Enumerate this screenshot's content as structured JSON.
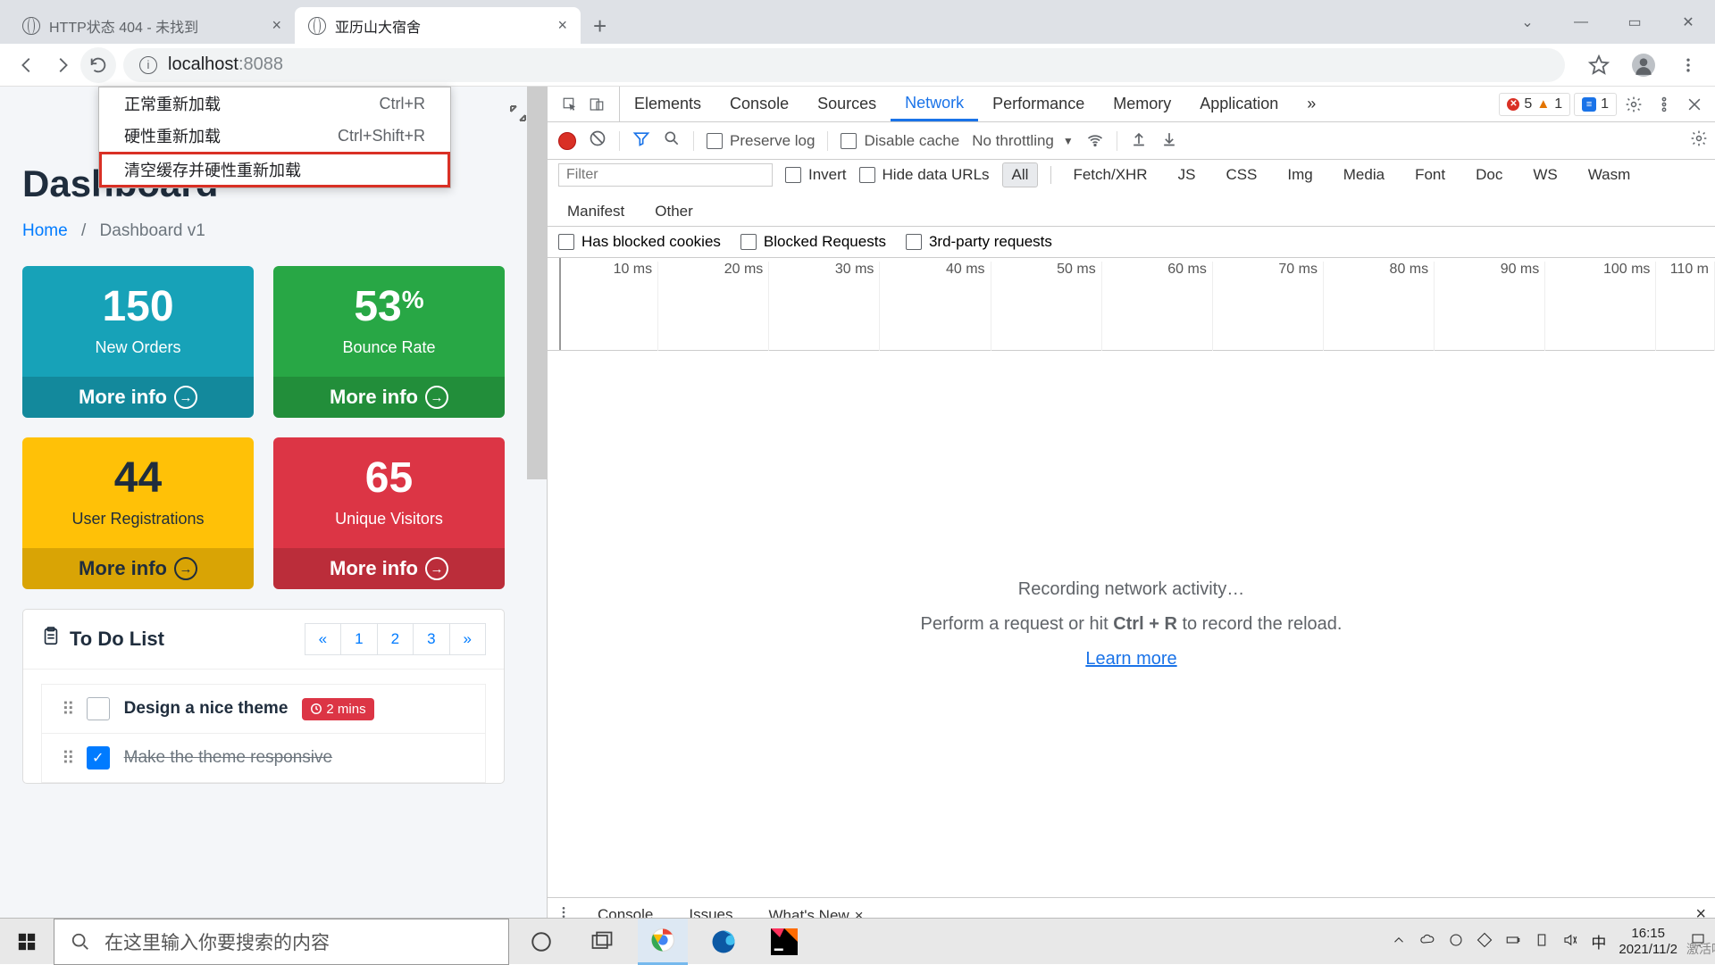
{
  "browser": {
    "tabs": [
      {
        "title": "HTTP状态 404 - 未找到",
        "active": false
      },
      {
        "title": "亚历山大宿舍",
        "active": true
      }
    ],
    "url_host": "localhost",
    "url_port": ":8088",
    "window_controls": {
      "dropdown": "⌄",
      "minimize": "—",
      "maximize": "▭",
      "close": "✕"
    }
  },
  "context_menu": {
    "items": [
      {
        "label": "正常重新加载",
        "shortcut": "Ctrl+R"
      },
      {
        "label": "硬性重新加载",
        "shortcut": "Ctrl+Shift+R"
      },
      {
        "label": "清空缓存并硬性重新加载",
        "shortcut": "",
        "highlighted": true
      }
    ]
  },
  "dashboard": {
    "title": "Dashboard",
    "breadcrumb": {
      "home": "Home",
      "sep": "/",
      "current": "Dashboard v1"
    },
    "stats": [
      {
        "value": "150",
        "label": "New Orders",
        "more": "More info",
        "color": "cyan"
      },
      {
        "value": "53",
        "suffix": "%",
        "label": "Bounce Rate",
        "more": "More info",
        "color": "green"
      },
      {
        "value": "44",
        "label": "User Registrations",
        "more": "More info",
        "color": "yellow"
      },
      {
        "value": "65",
        "label": "Unique Visitors",
        "more": "More info",
        "color": "red"
      }
    ],
    "todo": {
      "title": "To Do List",
      "pagination": [
        "«",
        "1",
        "2",
        "3",
        "»"
      ],
      "items": [
        {
          "text": "Design a nice theme",
          "badge": "2 mins",
          "done": false
        },
        {
          "text": "Make the theme responsive",
          "badge": "",
          "done": true
        }
      ]
    }
  },
  "devtools": {
    "tabs": [
      "Elements",
      "Console",
      "Sources",
      "Network",
      "Performance",
      "Memory",
      "Application"
    ],
    "active_tab": "Network",
    "more": "»",
    "badges": {
      "errors": "5",
      "warnings": "1",
      "issues": "1"
    },
    "toolbar": {
      "preserve_log": "Preserve log",
      "disable_cache": "Disable cache",
      "throttling": "No throttling"
    },
    "filter": {
      "placeholder": "Filter",
      "invert": "Invert",
      "hide_data": "Hide data URLs",
      "chips": [
        "All",
        "Fetch/XHR",
        "JS",
        "CSS",
        "Img",
        "Media",
        "Font",
        "Doc",
        "WS",
        "Wasm",
        "Manifest",
        "Other"
      ],
      "active_chip": "All"
    },
    "blocked": {
      "cookies": "Has blocked cookies",
      "requests": "Blocked Requests",
      "third_party": "3rd-party requests"
    },
    "timeline_ticks": [
      "10 ms",
      "20 ms",
      "30 ms",
      "40 ms",
      "50 ms",
      "60 ms",
      "70 ms",
      "80 ms",
      "90 ms",
      "100 ms",
      "110 m"
    ],
    "empty": {
      "title": "Recording network activity…",
      "sub_pre": "Perform a request or hit ",
      "sub_key": "Ctrl + R",
      "sub_post": " to record the reload.",
      "link": "Learn more"
    },
    "drawer": {
      "tabs": [
        "Console",
        "Issues",
        "What's New"
      ],
      "active": "What's New"
    }
  },
  "taskbar": {
    "search_placeholder": "在这里输入你要搜索的内容",
    "ime": "中",
    "time": "16:15",
    "date": "2021/11/2",
    "watermark": "激活哈尔灿"
  }
}
